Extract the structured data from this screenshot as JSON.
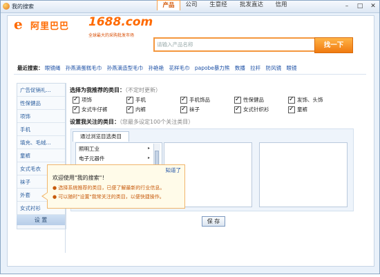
{
  "window": {
    "title": "我的搜索",
    "minimize": "–",
    "maximize": "□",
    "close": "✕"
  },
  "brand": {
    "logo_mark": "e",
    "logo_text": "阿里巴巴",
    "site_logo": "1688.com",
    "slogan": "全球最大的采购批发市场"
  },
  "search": {
    "tabs": [
      "产品",
      "公司",
      "生意经",
      "批发直达",
      "信用"
    ],
    "active_tab": 0,
    "placeholder": "请输入产品名称",
    "button_label": "找一下"
  },
  "recent": {
    "label": "最近搜索：",
    "items": [
      "眼镜绳",
      "孙燕滴蛋糕毛巾",
      "孙燕滴造型毛巾",
      "孙艳艳",
      "花样毛巾",
      "papobe暴力熊",
      "数播",
      "拉杆",
      "防风镜",
      "眼镜"
    ]
  },
  "sidebar": {
    "items": [
      "广告促销礼...",
      "性保健品",
      "项饰",
      "手机",
      "填充、毛绒...",
      "童裤",
      "女式毛衣",
      "袜子",
      "外套",
      "女式衬衫"
    ],
    "settings_label": "设 置"
  },
  "recommended": {
    "heading": "选择为我推荐的类目：",
    "note": "（不定时更新）",
    "checkboxes": [
      "项饰",
      "手机",
      "手机饰品",
      "性保健品",
      "发饰、头饰",
      "女式牛仔裤",
      "内裤",
      "袜子",
      "女式针织衫",
      "童裤"
    ]
  },
  "focus": {
    "heading": "设置我关注的类目：",
    "note": "（您最多设定100个关注类目）",
    "tab_label": "通过浏览目选类目",
    "categories": [
      "照明工业",
      "电子元器件"
    ]
  },
  "save_label": "保 存",
  "tooltip": {
    "close_label": "知道了",
    "title": "欢迎使用\"我的搜索\"！",
    "lines": [
      "● 选择系统推荐的类目，已便了解最新的行业信息。",
      "● 可以随时\"设置\"我常关注的类目，以便快捷操作。"
    ]
  },
  "colors": {
    "accent": "#ff6a00",
    "link": "#1b4fa5",
    "border": "#c5d4e5"
  }
}
